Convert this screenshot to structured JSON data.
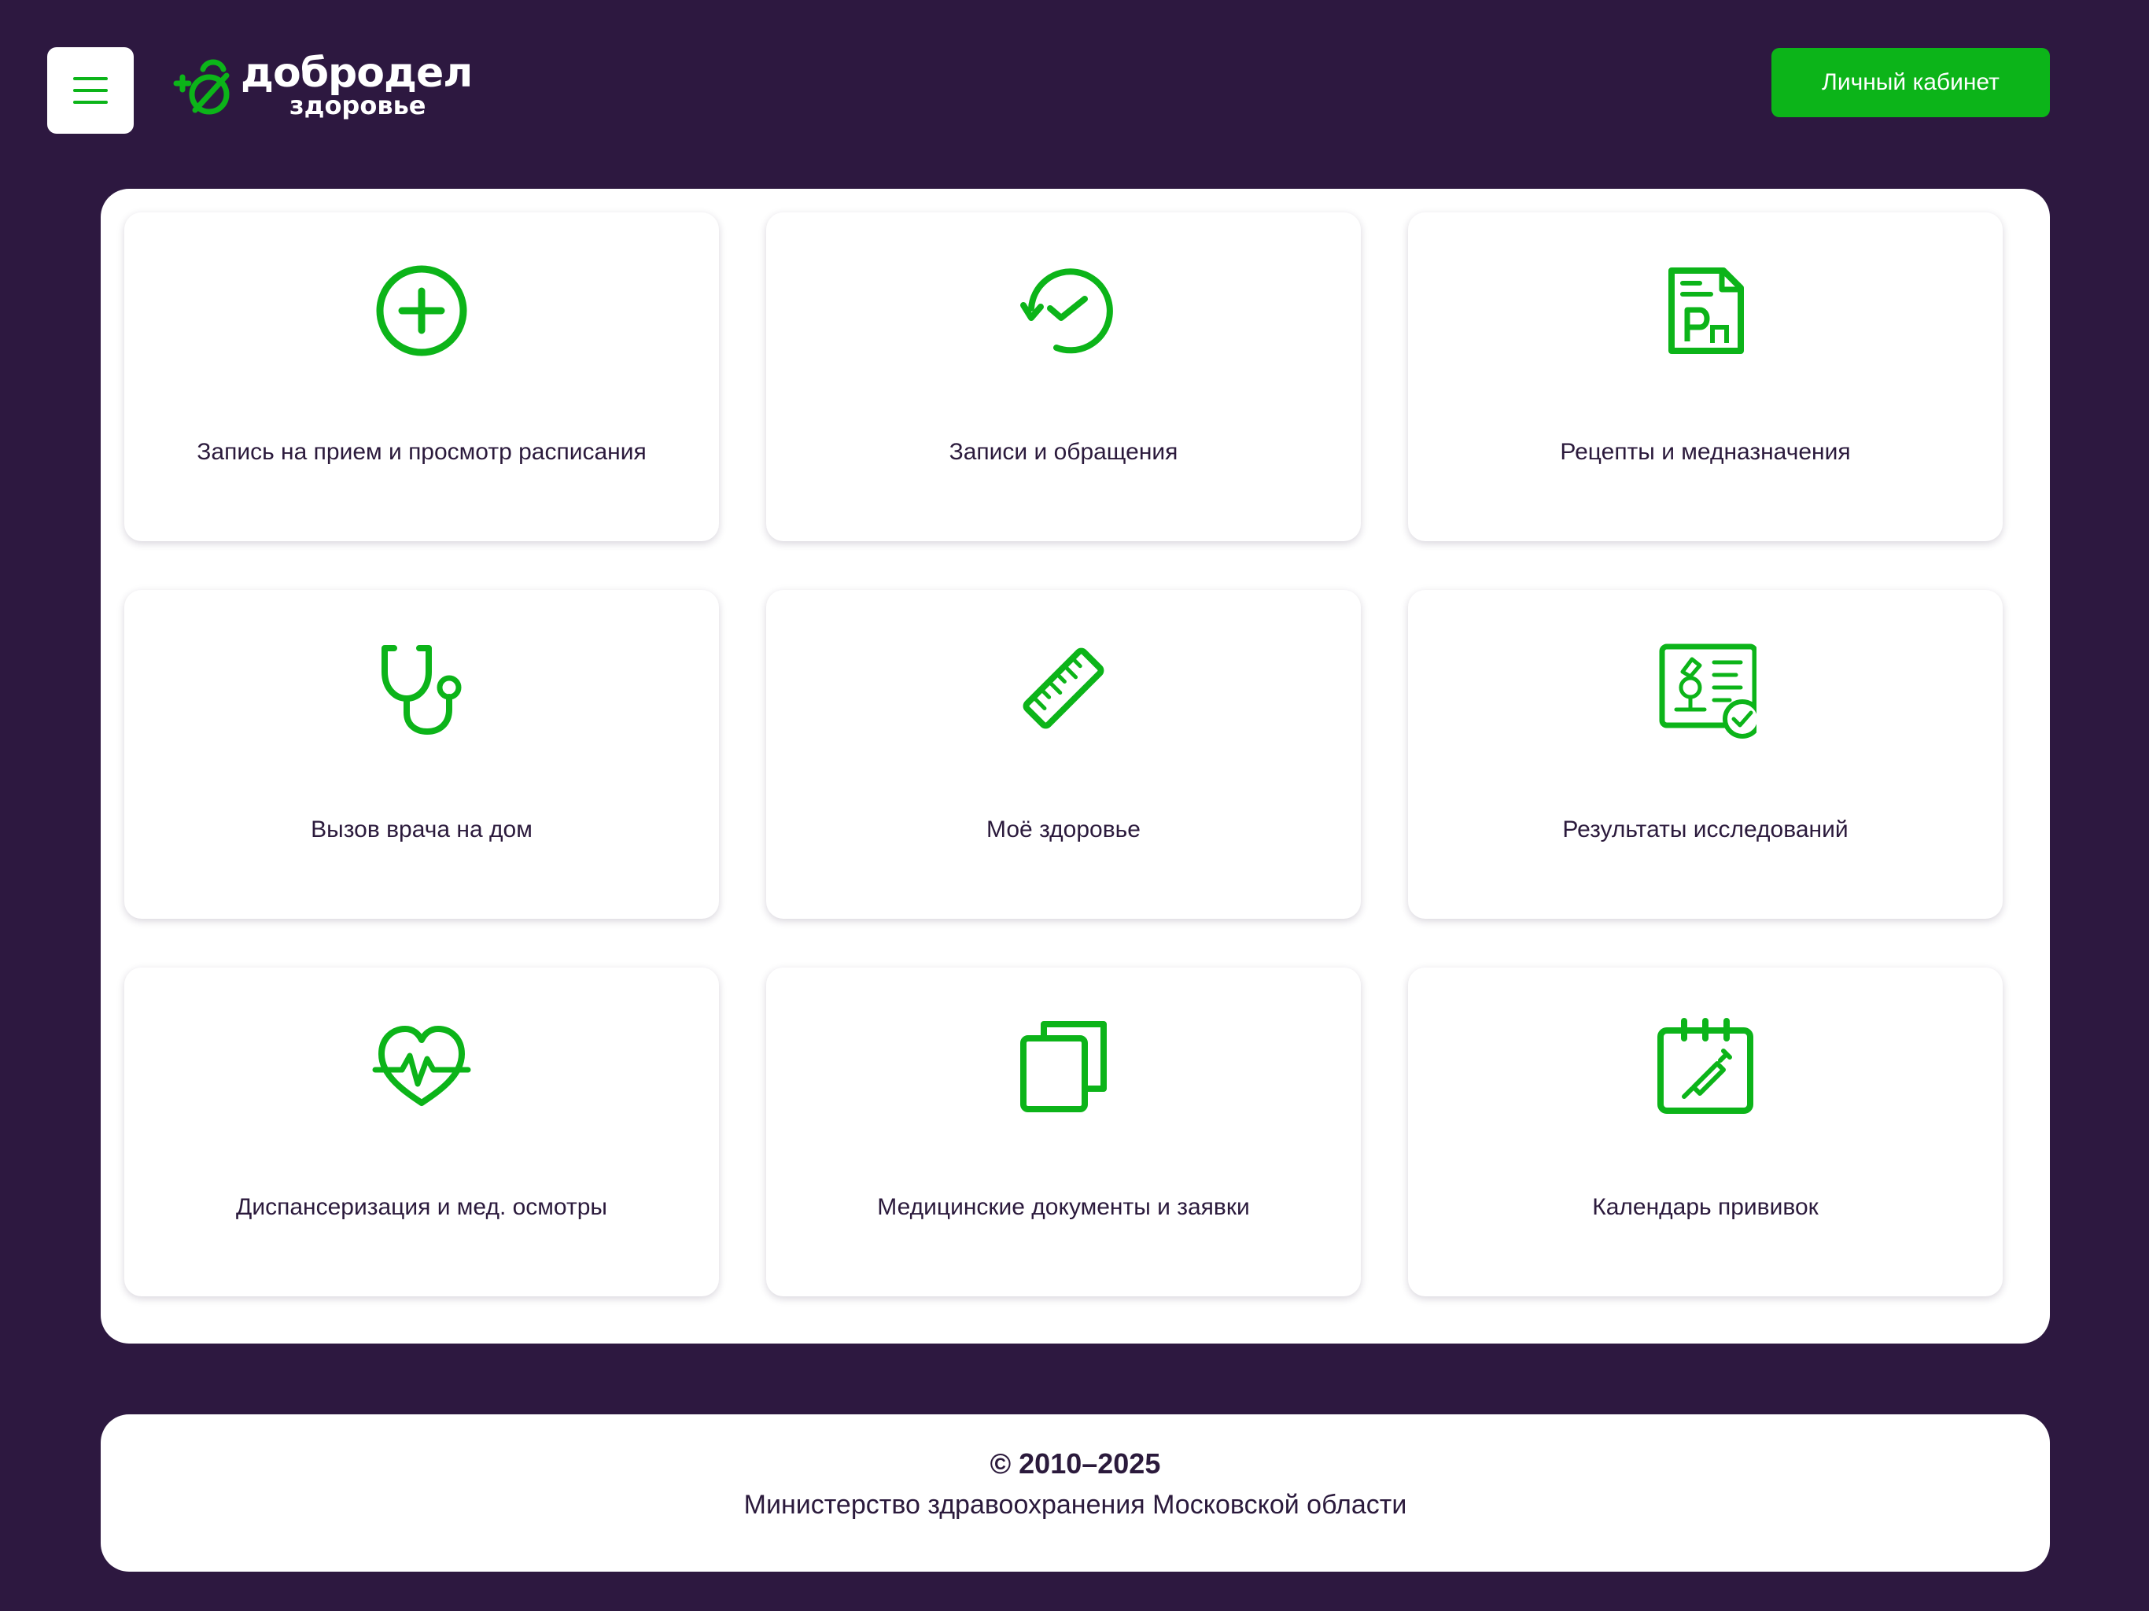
{
  "header": {
    "logo_word": "добродел",
    "logo_sub": "здоровье",
    "account_button": "Личный кабинет"
  },
  "cards": [
    {
      "label": "Запись на прием и просмотр расписания",
      "icon": "plus-circle-icon"
    },
    {
      "label": "Записи и обращения",
      "icon": "history-check-icon"
    },
    {
      "label": "Рецепты и медназначения",
      "icon": "prescription-icon"
    },
    {
      "label": "Вызов врача на дом",
      "icon": "stethoscope-icon"
    },
    {
      "label": "Моё здоровье",
      "icon": "ruler-icon"
    },
    {
      "label": "Результаты исследований",
      "icon": "lab-results-icon"
    },
    {
      "label": "Диспансеризация и мед. осмотры",
      "icon": "heart-pulse-icon"
    },
    {
      "label": "Медицинские документы и заявки",
      "icon": "documents-icon"
    },
    {
      "label": "Календарь прививок",
      "icon": "vaccine-calendar-icon"
    }
  ],
  "footer": {
    "copyright": "© 2010–2025",
    "ministry": "Министерство здравоохранения Московской области"
  },
  "colors": {
    "background": "#2d1840",
    "accent": "#0cb419",
    "text": "#2b1a3c"
  }
}
